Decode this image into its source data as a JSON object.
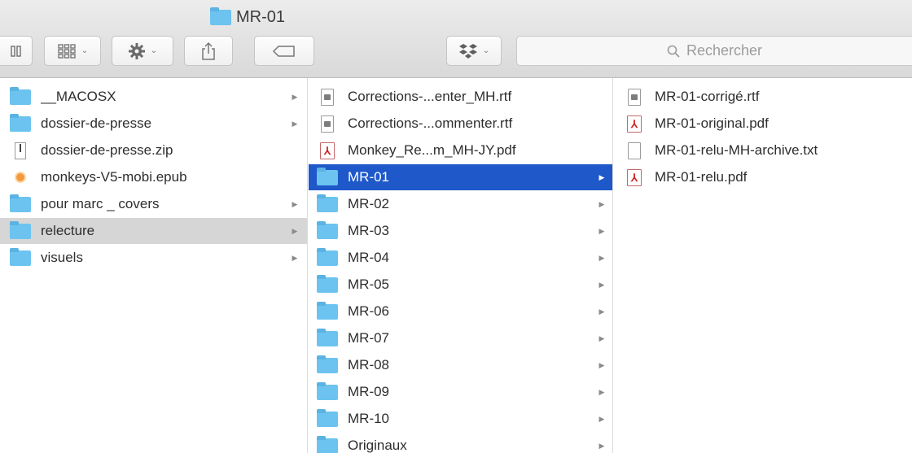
{
  "window": {
    "title": "MR-01"
  },
  "toolbar": {
    "view_icon": "grid-view-icon",
    "action_icon": "gear-icon",
    "share_icon": "share-icon",
    "tag_icon": "tag-icon",
    "dropbox_icon": "dropbox-icon",
    "chevron": "⌄",
    "search_placeholder": "Rechercher"
  },
  "column1": [
    {
      "label": "__MACOSX",
      "type": "folder",
      "has_children": true,
      "state": ""
    },
    {
      "label": "dossier-de-presse",
      "type": "folder",
      "has_children": true,
      "state": ""
    },
    {
      "label": "dossier-de-presse.zip",
      "type": "zip",
      "has_children": false,
      "state": ""
    },
    {
      "label": "monkeys-V5-mobi.epub",
      "type": "epub",
      "has_children": false,
      "state": ""
    },
    {
      "label": "pour marc _ covers",
      "type": "folder",
      "has_children": true,
      "state": ""
    },
    {
      "label": "relecture",
      "type": "folder",
      "has_children": true,
      "state": "selected-grey"
    },
    {
      "label": "visuels",
      "type": "folder",
      "has_children": true,
      "state": ""
    }
  ],
  "column2": [
    {
      "label": "Corrections-...enter_MH.rtf",
      "type": "rtf",
      "has_children": false,
      "state": ""
    },
    {
      "label": "Corrections-...ommenter.rtf",
      "type": "rtf",
      "has_children": false,
      "state": ""
    },
    {
      "label": "Monkey_Re...m_MH-JY.pdf",
      "type": "pdf",
      "has_children": false,
      "state": ""
    },
    {
      "label": "MR-01",
      "type": "folder",
      "has_children": true,
      "state": "selected-blue"
    },
    {
      "label": "MR-02",
      "type": "folder",
      "has_children": true,
      "state": ""
    },
    {
      "label": "MR-03",
      "type": "folder",
      "has_children": true,
      "state": ""
    },
    {
      "label": "MR-04",
      "type": "folder",
      "has_children": true,
      "state": ""
    },
    {
      "label": "MR-05",
      "type": "folder",
      "has_children": true,
      "state": ""
    },
    {
      "label": "MR-06",
      "type": "folder",
      "has_children": true,
      "state": ""
    },
    {
      "label": "MR-07",
      "type": "folder",
      "has_children": true,
      "state": ""
    },
    {
      "label": "MR-08",
      "type": "folder",
      "has_children": true,
      "state": ""
    },
    {
      "label": "MR-09",
      "type": "folder",
      "has_children": true,
      "state": ""
    },
    {
      "label": "MR-10",
      "type": "folder",
      "has_children": true,
      "state": ""
    },
    {
      "label": "Originaux",
      "type": "folder",
      "has_children": true,
      "state": ""
    }
  ],
  "column3": [
    {
      "label": "MR-01-corrigé.rtf",
      "type": "rtf",
      "has_children": false,
      "state": ""
    },
    {
      "label": "MR-01-original.pdf",
      "type": "pdf",
      "has_children": false,
      "state": ""
    },
    {
      "label": "MR-01-relu-MH-archive.txt",
      "type": "txt",
      "has_children": false,
      "state": ""
    },
    {
      "label": "MR-01-relu.pdf",
      "type": "pdf",
      "has_children": false,
      "state": ""
    }
  ],
  "colors": {
    "selection_blue": "#1e58c9",
    "selection_grey": "#d6d6d6",
    "folder_blue": "#6cc3ef",
    "pdf_red": "#d21f1f"
  }
}
